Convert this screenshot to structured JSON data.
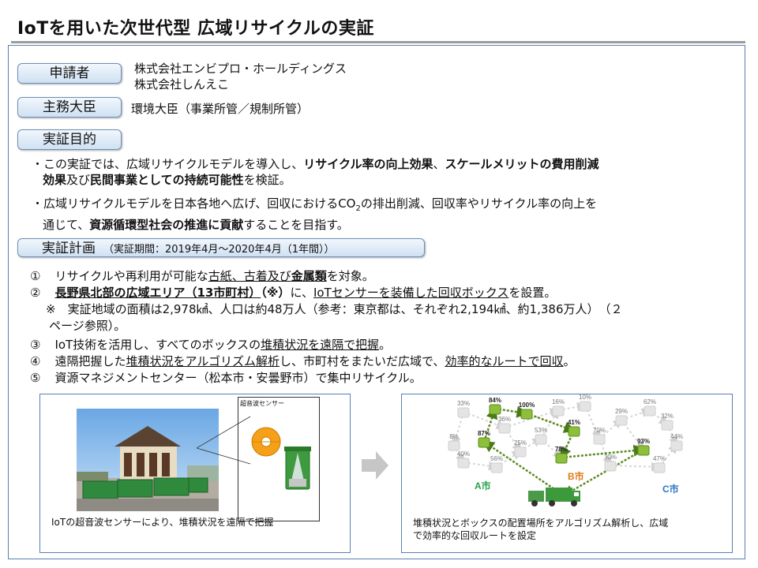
{
  "header": {
    "title": "IoTを用いた次世代型 広域リサイクルの実証"
  },
  "applicant": {
    "label": "申請者",
    "values": [
      "株式会社エンビプロ・ホールディングス",
      "株式会社しんえこ"
    ]
  },
  "minister": {
    "label": "主務大臣",
    "value": "環境大臣（事業所管／規制所管）"
  },
  "purpose": {
    "label": "実証目的",
    "b1": {
      "line1_a": "・この実証では、広域リサイクルモデルを導入し、",
      "line1_b": "リサイクル率の向上効果",
      "line1_c": "、",
      "line1_d": "スケールメリットの費用削減",
      "line2_a": "効果",
      "line2_b": "及び",
      "line2_c": "民間事業としての持続可能性",
      "line2_d": "を検証。"
    },
    "b2": {
      "line1_a": "・広域リサイクルモデルを日本各地へ広げ、回収におけるCO",
      "line1_sub": "2",
      "line1_b": "の排出削減、回収率やリサイクル率の向上を",
      "line2_a": "通じて、",
      "line2_b": "資源循環型社会の推進に貢献",
      "line2_c": "することを目指す。"
    }
  },
  "plan": {
    "label": "実証計画",
    "period": "（実証期間：2019年4月～2020年4月（1年間））",
    "i1": {
      "num": "①",
      "a": "リサイクルや再利用が可能な",
      "b": "古紙、古着及び",
      "c": "金属類",
      "d": "を対象。"
    },
    "i2": {
      "num": "②",
      "a": "長野県北部の広域エリア（13市町村）",
      "b": "（※）",
      "c": "に、",
      "d": "IoTセンサーを装備した回収ボックス",
      "e": "を設置。"
    },
    "note1": "※　実証地域の面積は2,978㎢、人口は約48万人（参考：東京都は、それぞれ2,194㎢、約1,386万人）　（２",
    "note2": "ページ参照）。",
    "i3": {
      "num": "③",
      "a": "IoT技術を活用し、すべてのボックスの",
      "b": "堆積状況を遠隔で把握",
      "c": "。"
    },
    "i4": {
      "num": "④",
      "a": "遠隔把握した",
      "b": "堆積状況をアルゴリズム解析",
      "c": "し、市町村をまたいだ広域で、",
      "d": "効率的なルートで回収",
      "e": "。"
    },
    "i5": {
      "num": "⑤",
      "a": "資源マネジメントセンター（松本市・安曇野市）で集中リサイクル。"
    }
  },
  "left_panel": {
    "sensor_label": "超音波センサー",
    "caption": "IoTの超音波センサーにより、堆積状況を遠隔で把握"
  },
  "right_panel": {
    "nodes": [
      "33%",
      "84%",
      "100%",
      "16%",
      "10%",
      "29%",
      "62%",
      "32%",
      "36%",
      "53%",
      "41%",
      "70%",
      "8%",
      "87%",
      "25%",
      "78%",
      "93%",
      "44%",
      "40%",
      "56%",
      "30%",
      "47%"
    ],
    "cities": [
      "A市",
      "B市",
      "C市"
    ],
    "caption1": "堆積状況とボックスの配置場所をアルゴリズム解析し、広域",
    "caption2": "で効率的な回収ルートを設定"
  },
  "colors": {
    "accent_green": "#27a24a",
    "route_green": "#4a7a1a",
    "city_orange": "#e07b1a",
    "city_blue": "#2f78c4",
    "frame_blue": "#5b7fb0"
  }
}
